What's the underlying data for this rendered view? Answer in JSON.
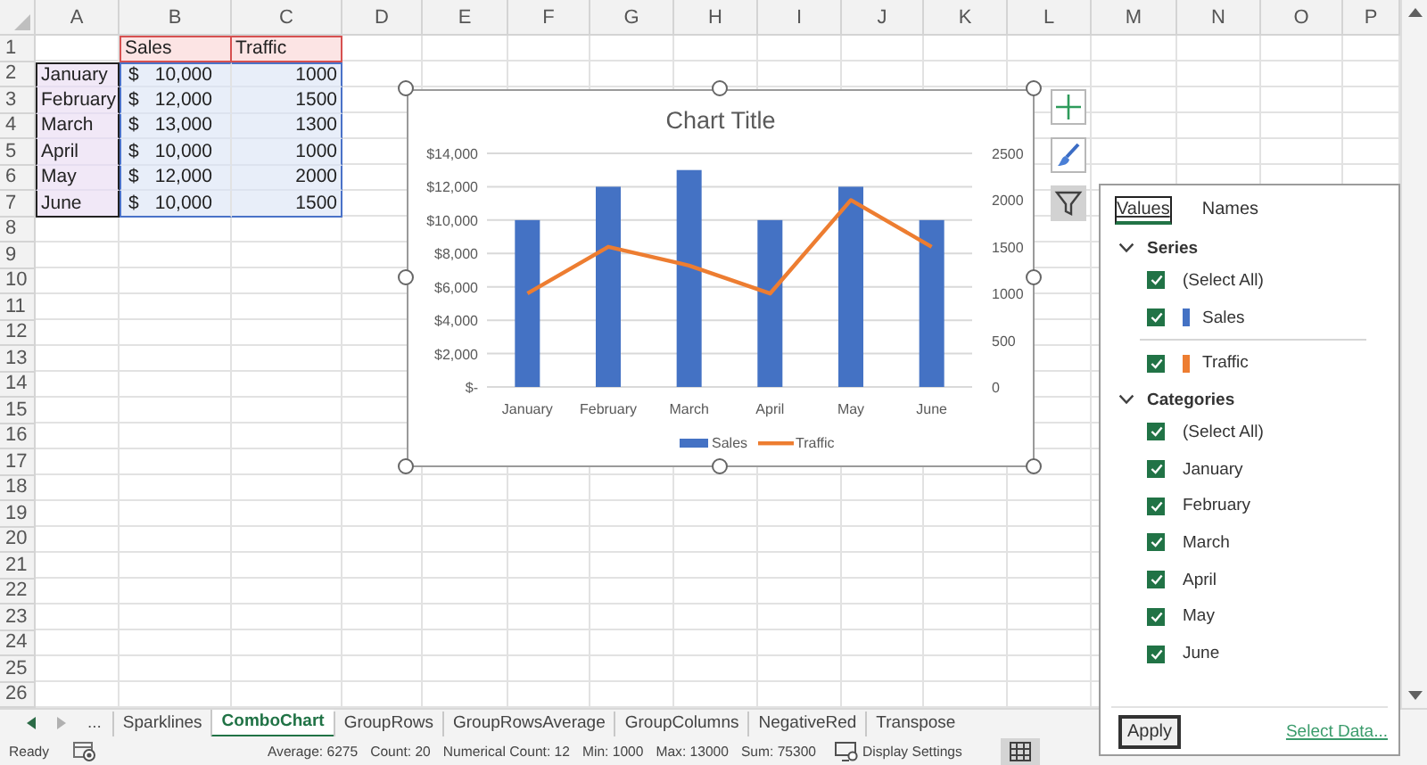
{
  "sheet": {
    "columns": [
      "A",
      "B",
      "C",
      "D",
      "E",
      "F",
      "G",
      "H",
      "I",
      "J",
      "K",
      "L",
      "M",
      "N",
      "O",
      "P"
    ],
    "row_numbers": [
      "1",
      "2",
      "3",
      "4",
      "5",
      "6",
      "7",
      "8",
      "9",
      "10",
      "11",
      "12",
      "13",
      "14",
      "15",
      "16",
      "17",
      "18",
      "19",
      "20",
      "21",
      "22",
      "23",
      "24",
      "25",
      "26"
    ],
    "header": {
      "column_b": "Sales",
      "column_c": "Traffic"
    },
    "data_rows": [
      {
        "month": "January",
        "currency": "$",
        "sales": "10,000",
        "traffic": "1000"
      },
      {
        "month": "February",
        "currency": "$",
        "sales": "12,000",
        "traffic": "1500"
      },
      {
        "month": "March",
        "currency": "$",
        "sales": "13,000",
        "traffic": "1300"
      },
      {
        "month": "April",
        "currency": "$",
        "sales": "10,000",
        "traffic": "1000"
      },
      {
        "month": "May",
        "currency": "$",
        "sales": "12,000",
        "traffic": "2000"
      },
      {
        "month": "June",
        "currency": "$",
        "sales": "10,000",
        "traffic": "1500"
      }
    ]
  },
  "chart": {
    "chart_data": {
      "type": "bar",
      "title": "Chart Title",
      "categories": [
        "January",
        "February",
        "March",
        "April",
        "May",
        "June"
      ],
      "series": [
        {
          "name": "Sales",
          "color": "#4472c4",
          "values": [
            10000,
            12000,
            13000,
            10000,
            12000,
            10000
          ]
        },
        {
          "name": "Traffic",
          "color": "#ed7d31",
          "type": "line",
          "axis": "y2",
          "values": [
            1000,
            1500,
            1300,
            1000,
            2000,
            1500
          ]
        }
      ],
      "grid": true,
      "legend": "bottom",
      "ylim": [
        0,
        14000
      ],
      "yticks": [
        {
          "value": 0,
          "label": "$-"
        },
        {
          "value": 2000,
          "label": "$2,000"
        },
        {
          "value": 4000,
          "label": "$4,000"
        },
        {
          "value": 6000,
          "label": "$6,000"
        },
        {
          "value": 8000,
          "label": "$8,000"
        },
        {
          "value": 10000,
          "label": "$10,000"
        },
        {
          "value": 12000,
          "label": "$12,000"
        },
        {
          "value": 14000,
          "label": "$14,000"
        }
      ],
      "y2lim": [
        0,
        2500
      ],
      "y2ticks": [
        0,
        500,
        1000,
        1500,
        2000,
        2500
      ]
    }
  },
  "chart_buttons": [
    {
      "kind": "add",
      "selected": false
    },
    {
      "kind": "style",
      "selected": false
    },
    {
      "kind": "filter",
      "selected": true
    }
  ],
  "filter_panel": {
    "tabs": [
      {
        "label": "Values",
        "selected": true
      },
      {
        "label": "Names",
        "selected": false
      }
    ],
    "sections": [
      {
        "title": "Series",
        "expanded": true,
        "items": [
          {
            "label": "(Select All)",
            "checked": true
          },
          {
            "label": "Sales",
            "checked": true,
            "color": "#4472c4"
          },
          {
            "label": "Traffic",
            "checked": true,
            "color": "#ed7d31",
            "separator_before": true
          }
        ]
      },
      {
        "title": "Categories",
        "expanded": true,
        "items": [
          {
            "label": "(Select All)",
            "checked": true
          },
          {
            "label": "January",
            "checked": true
          },
          {
            "label": "February",
            "checked": true
          },
          {
            "label": "March",
            "checked": true
          },
          {
            "label": "April",
            "checked": true
          },
          {
            "label": "May",
            "checked": true
          },
          {
            "label": "June",
            "checked": true
          }
        ]
      }
    ],
    "apply_button": "Apply",
    "select_data_link": "Select Data..."
  },
  "sheet_tabs": {
    "overflow": "...",
    "tabs": [
      {
        "label": "Sparklines",
        "selected": false
      },
      {
        "label": "ComboChart",
        "selected": true
      },
      {
        "label": "GroupRows",
        "selected": false
      },
      {
        "label": "GroupRowsAverage",
        "selected": false
      },
      {
        "label": "GroupColumns",
        "selected": false
      },
      {
        "label": "NegativeRed",
        "selected": false
      },
      {
        "label": "Transpose",
        "selected": false
      }
    ]
  },
  "status_bar": {
    "mode": "Ready",
    "stats": [
      "Average: 6275",
      "Count: 20",
      "Numerical Count: 12",
      "Min: 1000",
      "Max: 13000",
      "Sum: 75300"
    ],
    "display_settings": "Display Settings",
    "views": [
      {
        "kind": "normal",
        "selected": true
      }
    ]
  }
}
